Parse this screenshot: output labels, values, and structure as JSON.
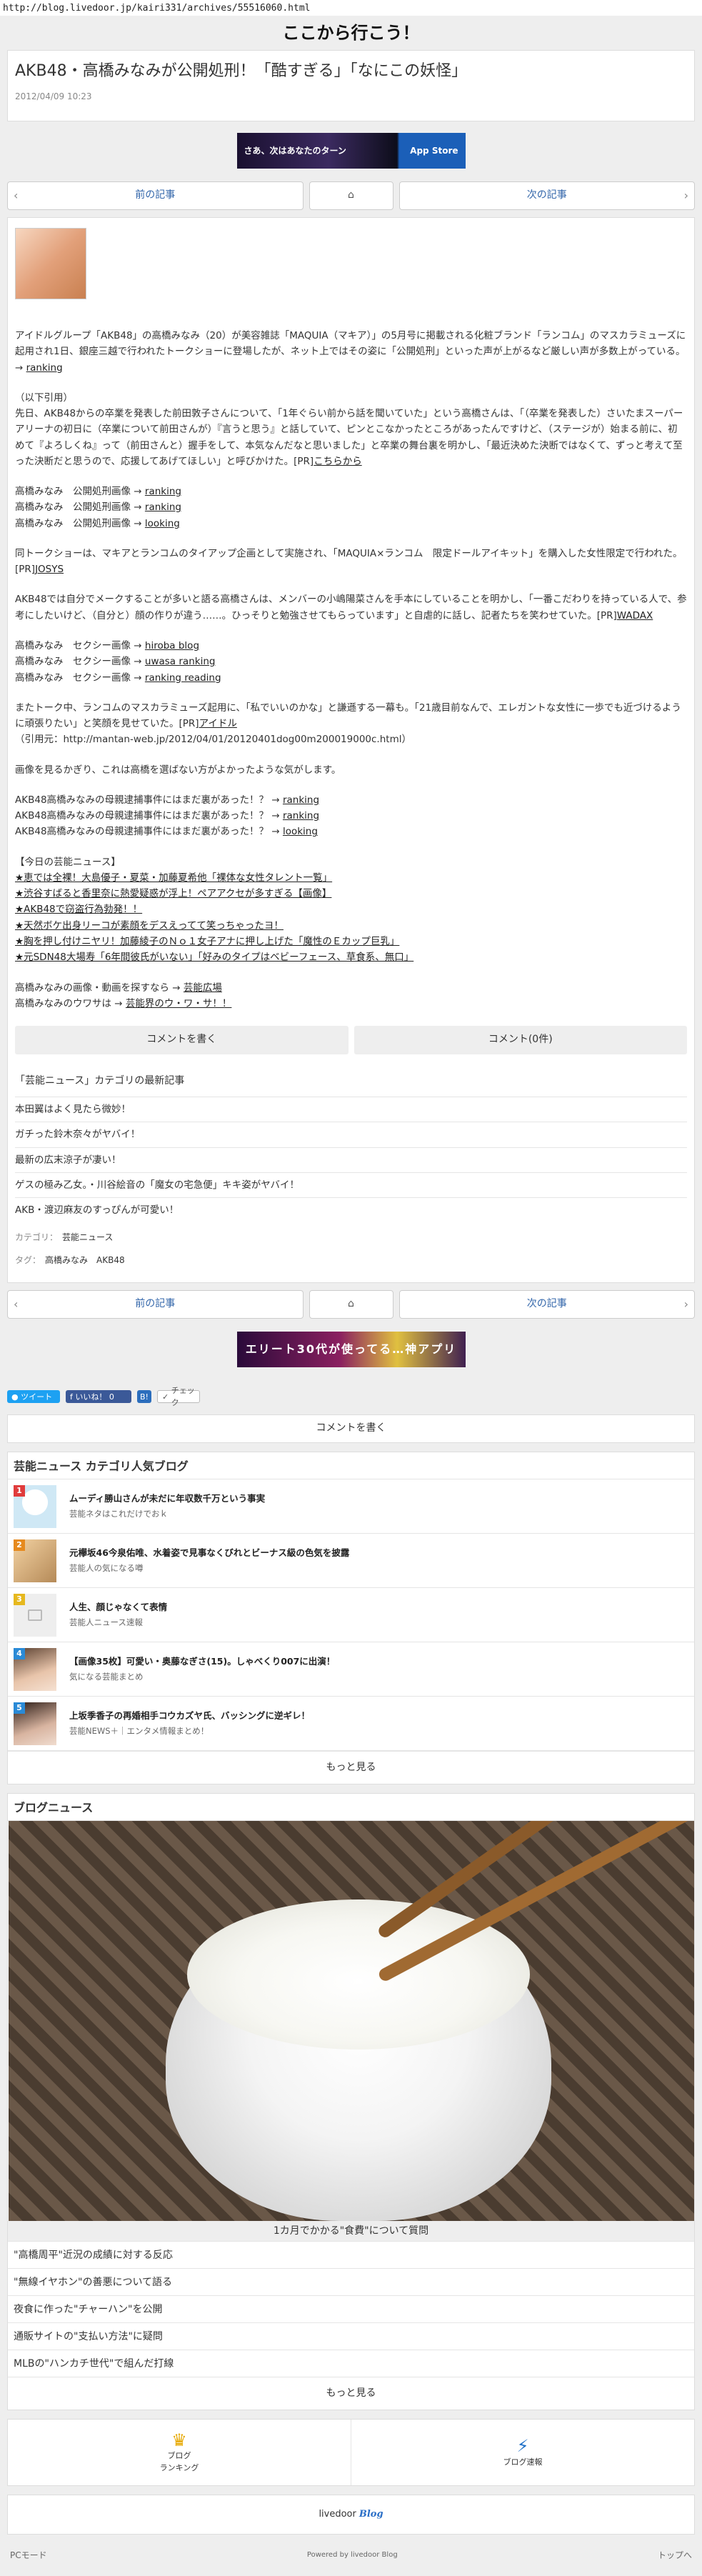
{
  "url": "http://blog.livedoor.jp/kairi331/archives/55516060.html",
  "blog_title": "ここから行こう！",
  "article": {
    "title": "AKB48・高橋みなみが公開処刑！「酷すぎる」「なにこの妖怪」",
    "date": "2012/04/09 10:23"
  },
  "banner_top": {
    "left": "さあ、次はあなたのターン",
    "right": "App Store"
  },
  "banner_bottom": {
    "text": "エリート30代が使ってる…神アプリ"
  },
  "pager": {
    "prev": "前の記事",
    "next": "次の記事"
  },
  "body": {
    "intro": "アイドルグループ「AKB48」の高橋みなみ（20）が美容雑誌「MAQUIA（マキア）」の5月号に掲載される化粧ブランド「ランコム」のマスカラミューズに起用され1日、銀座三越で行われたトークショーに登場したが、ネット上ではその姿に「公開処刑」といった声が上がるなど厳しい声が多数上がっている。→",
    "intro_link": "ranking",
    "quote_label": "（以下引用）",
    "quote": "先日、AKB48からの卒業を発表した前田敦子さんについて、「1年ぐらい前から話を聞いていた」という高橋さんは、「（卒業を発表した）さいたまスーパーアリーナの初日に（卒業について前田さんが）『言うと思う』と話していて、ピンとこなかったところがあったんですけど、（ステージが）始まる前に、初めて『よろしくね』って（前田さんと）握手をして、本気なんだなと思いました」と卒業の舞台裏を明かし、「最近決めた決断ではなくて、ずっと考えて至った決断だと思うので、応援してあげてほしい」と呼びかけた。[PR]",
    "quote_link": "こちらから",
    "pic_lines": [
      {
        "text": "高橋みなみ　公開処刑画像 →",
        "link": "ranking"
      },
      {
        "text": "高橋みなみ　公開処刑画像 →",
        "link": "ranking"
      },
      {
        "text": "高橋みなみ　公開処刑画像 →",
        "link": "looking"
      }
    ],
    "p2": "同トークショーは、マキアとランコムのタイアップ企画として実施され、「MAQUIA×ランコム　限定ドールアイキット」を購入した女性限定で行われた。[PR]",
    "p2_link": "JOSYS",
    "p3": "AKB48では自分でメークすることが多いと語る高橋さんは、メンバーの小嶋陽菜さんを手本にしていることを明かし、「一番こだわりを持っている人で、参考にしたいけど、（自分と）顔の作りが違う……。ひっそりと勉強させてもらっています」と自虐的に話し、記者たちを笑わせていた。[PR]",
    "p3_link": "WADAX",
    "sexy_lines": [
      {
        "text": "高橋みなみ　セクシー画像 →",
        "link": "hiroba blog"
      },
      {
        "text": "高橋みなみ　セクシー画像 →",
        "link": "uwasa ranking"
      },
      {
        "text": "高橋みなみ　セクシー画像 →",
        "link": "ranking reading"
      }
    ],
    "p4": "またトーク中、ランコムのマスカラミューズ起用に、「私でいいのかな」と謙遜する一幕も。「21歳目前なんで、エレガントな女性に一歩でも近づけるように頑張りたい」と笑顔を見せていた。[PR]",
    "p4_link": "アイドル",
    "p4_source": "（引用元：http://mantan-web.jp/2012/04/01/20120401dog00m200019000c.html）",
    "p5": "画像を見るかぎり、これは高橋を選ばない方がよかったような気がします。",
    "mother_lines": [
      {
        "text": "AKB48高橋みなみの母親逮捕事件にはまだ裏があった！？ →",
        "link": "ranking"
      },
      {
        "text": "AKB48高橋みなみの母親逮捕事件にはまだ裏があった！？ →",
        "link": "ranking"
      },
      {
        "text": "AKB48高橋みなみの母親逮捕事件にはまだ裏があった！？ →",
        "link": "looking"
      }
    ],
    "today_label": "【今日の芸能ニュース】",
    "today_items": [
      "★恵では全裸！大島優子・夏菜・加藤夏希他「裸体な女性タレント一覧」",
      "★渋谷すばると香里奈に熱愛疑惑が浮上！ペアアクセが多すぎる【画像】",
      "★AKB48で窃盗行為勃発！！",
      "★天然ボケ出身リーコが素顔をデスえってて笑っちゃったヨ！",
      "★胸を押し付けニヤリ！加藤綾子のＮｏ１女子アナに押し上げた「魔性のＥカップ巨乳」",
      "★元SDN48大場寿「6年間彼氏がいない」「好みのタイプはベビーフェース、草食系、無口」"
    ],
    "closing": [
      {
        "text": "高橋みなみの画像・動画を探すなら →",
        "link": "芸能広場"
      },
      {
        "text": "高橋みなみのウワサは →",
        "link": "芸能界のウ・ワ・サ！！"
      }
    ]
  },
  "comment_actions": {
    "write": "コメントを書く",
    "count": "コメント(0件)"
  },
  "related": {
    "heading": "「芸能ニュース」カテゴリの最新記事",
    "items": [
      "本田翼はよく見たら微妙！",
      "ガチった鈴木奈々がヤバイ！",
      "最新の広末涼子が凄い！",
      "ゲスの極み乙女。・川谷絵音の「魔女の宅急便」キキ姿がヤバイ！",
      "AKB・渡辺麻友のすっぴんが可愛い！"
    ]
  },
  "meta": {
    "category_label": "カテゴリ：",
    "category": "芸能ニュース",
    "tag_label": "タグ：",
    "tags": "高橋みなみ　AKB48"
  },
  "share": {
    "tweet": "ツイート",
    "like": "いいね！ 0",
    "hatena": "B!",
    "check": "チェック"
  },
  "comment_write": "コメントを書く",
  "popular": {
    "title": "芸能ニュース カテゴリ人気ブログ",
    "items": [
      {
        "rank": "1",
        "title": "ムーディ勝山さんが未だに年収数千万という事実",
        "sub": "芸能ネタはこれだけでおｋ",
        "color": "#e03c3c"
      },
      {
        "rank": "2",
        "title": "元欅坂46今泉佑唯、水着姿で見事なくびれとビーナス級の色気を披露",
        "sub": "芸能人の気になる噂",
        "color": "#e68a1e"
      },
      {
        "rank": "3",
        "title": "人生、顔じゃなくて表情",
        "sub": "芸能人ニュース速報",
        "color": "#e6b81e"
      },
      {
        "rank": "4",
        "title": "【画像35枚】可愛い・奥藤なぎさ(15)。しゃべくり007に出演！",
        "sub": "気になる芸能まとめ",
        "color": "#2a8ad6"
      },
      {
        "rank": "5",
        "title": "上坂季香子の再婚相手コウカズヤ氏、バッシングに逆ギレ！",
        "sub": "芸能NEWS＋｜エンタメ情報まとめ！",
        "color": "#2a8ad6"
      }
    ],
    "more": "もっと見る"
  },
  "blog_news": {
    "title": "ブログニュース",
    "caption": "1カ月でかかる\"食費\"について質問",
    "items": [
      "\"高橋周平\"近況の成績に対する反応",
      "\"無線イヤホン\"の善悪について語る",
      "夜食に作った\"チャーハン\"を公開",
      "通販サイトの\"支払い方法\"に疑問",
      "MLBの\"ハンカチ世代\"で組んだ打線"
    ],
    "more": "もっと見る"
  },
  "bottom_nav": {
    "ranking": "ブログ\nランキング",
    "news": "ブログ速報"
  },
  "footer": {
    "logo_text": "livedoor",
    "logo_blog": "Blog",
    "pc_mode": "PCモード",
    "powered": "Powered by livedoor Blog",
    "top": "トップへ"
  }
}
